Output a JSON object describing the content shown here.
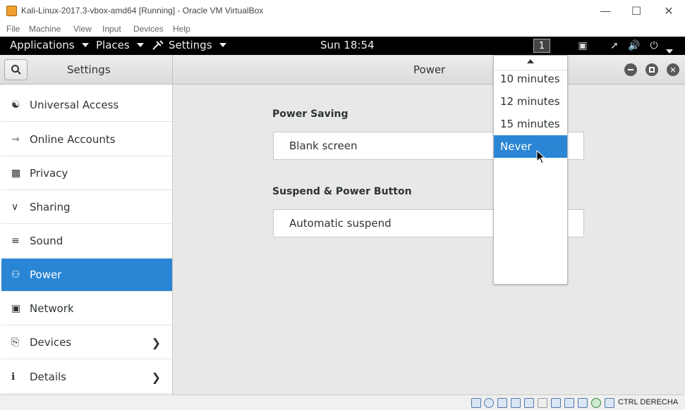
{
  "window": {
    "title": "Kali-Linux-2017.3-vbox-amd64 [Running] - Oracle VM VirtualBox",
    "minimize_icon": "minimize-icon",
    "maximize_icon": "maximize-icon",
    "close_icon": "close-icon"
  },
  "vbox_menu": [
    "File",
    "Machine",
    "View",
    "Input",
    "Devices",
    "Help"
  ],
  "topbar": {
    "applications": "Applications",
    "places": "Places",
    "settings": "Settings",
    "clock": "Sun 18:54",
    "workspace": "1"
  },
  "header": {
    "left_title": "Settings",
    "main_title": "Power"
  },
  "sidebar": {
    "items": [
      {
        "label": "Universal Access",
        "icon": "universal-access-icon"
      },
      {
        "label": "Online Accounts",
        "icon": "online-accounts-icon"
      },
      {
        "label": "Privacy",
        "icon": "privacy-icon"
      },
      {
        "label": "Sharing",
        "icon": "sharing-icon"
      },
      {
        "label": "Sound",
        "icon": "sound-icon"
      },
      {
        "label": "Power",
        "icon": "power-icon"
      },
      {
        "label": "Network",
        "icon": "network-icon"
      },
      {
        "label": "Devices",
        "icon": "devices-icon"
      },
      {
        "label": "Details",
        "icon": "details-icon"
      }
    ],
    "active": "Power"
  },
  "power": {
    "power_saving_title": "Power Saving",
    "blank_screen_label": "Blank screen",
    "suspend_title": "Suspend & Power Button",
    "automatic_suspend_label": "Automatic suspend"
  },
  "dropdown": {
    "options": [
      "10 minutes",
      "12 minutes",
      "15 minutes",
      "Never"
    ],
    "selected": "Never"
  },
  "statusbar": {
    "host_key": "CTRL DERECHA"
  },
  "colors": {
    "accent": "#2a86d4",
    "topbar": "#000000"
  }
}
